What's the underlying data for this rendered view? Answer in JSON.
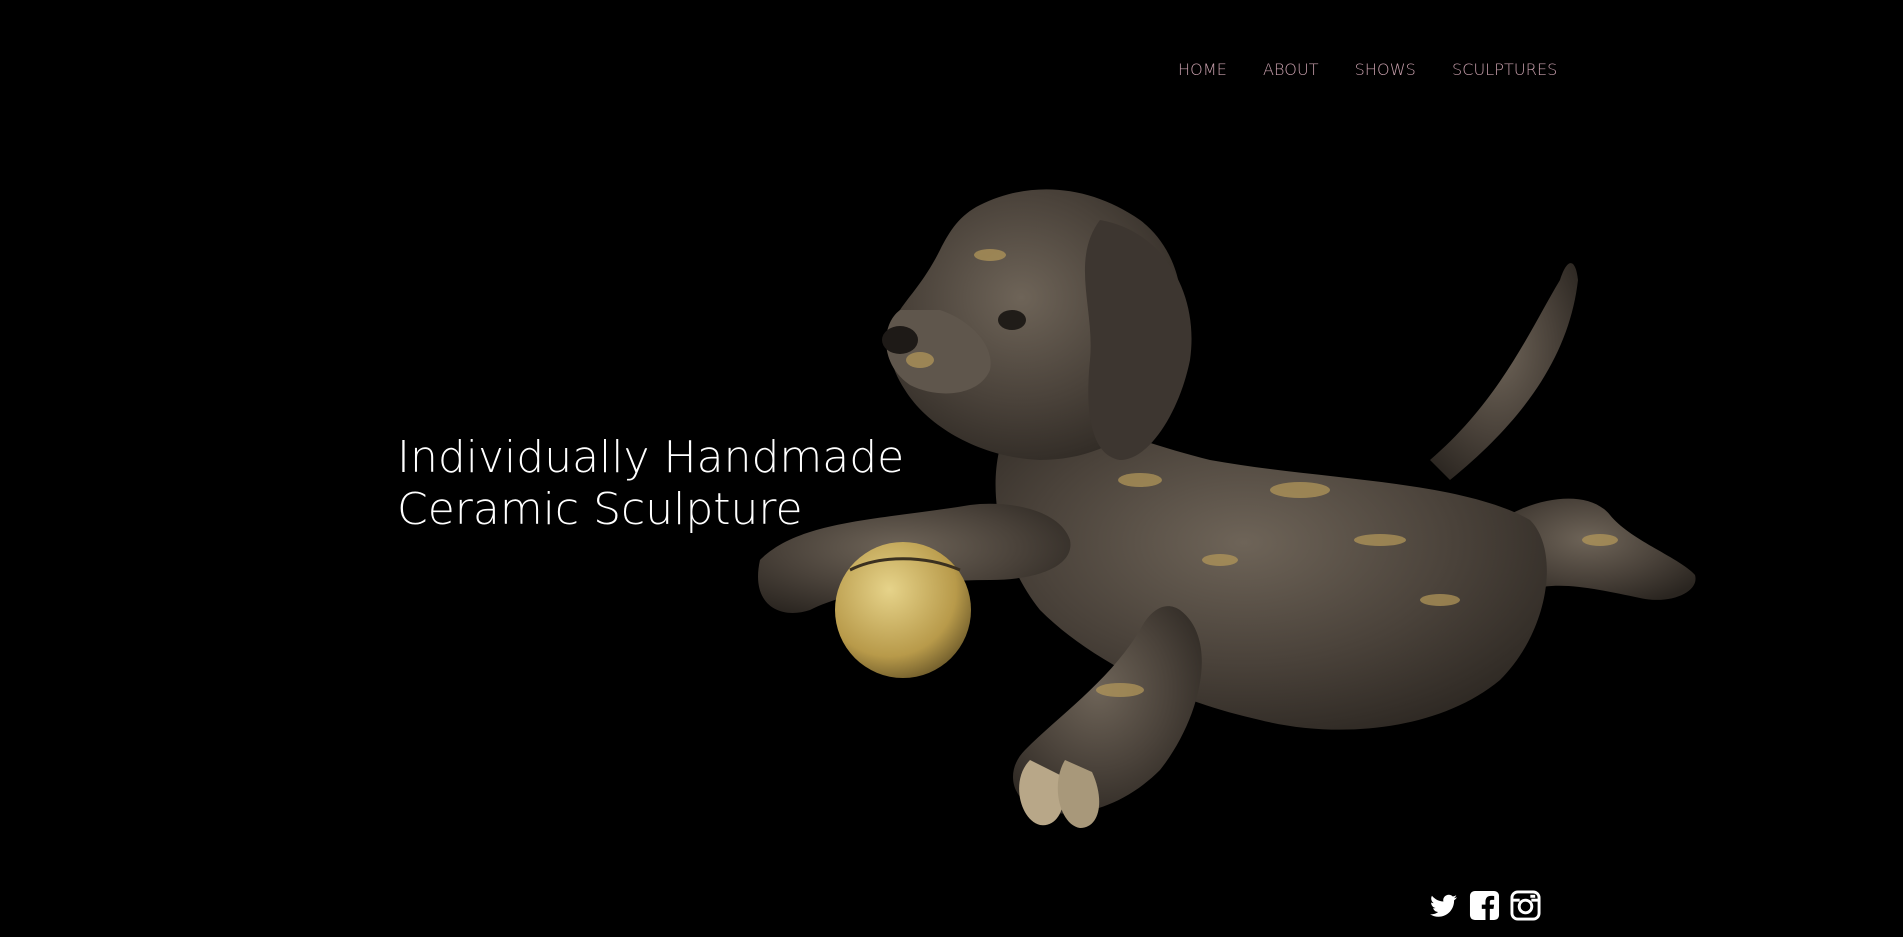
{
  "nav": {
    "items": [
      {
        "label": "HOME"
      },
      {
        "label": "ABOUT"
      },
      {
        "label": "SHOWS"
      },
      {
        "label": "SCULPTURES"
      }
    ]
  },
  "hero": {
    "line1": "Individually Handmade",
    "line2": "Ceramic Sculpture"
  },
  "image": {
    "subject": "ceramic-dog-sculpture-with-ball"
  },
  "social": {
    "icons": [
      "twitter-icon",
      "facebook-icon",
      "instagram-icon"
    ]
  },
  "colors": {
    "background": "#000000",
    "nav_text": "#c9a0ad",
    "hero_text": "#ffffff"
  }
}
